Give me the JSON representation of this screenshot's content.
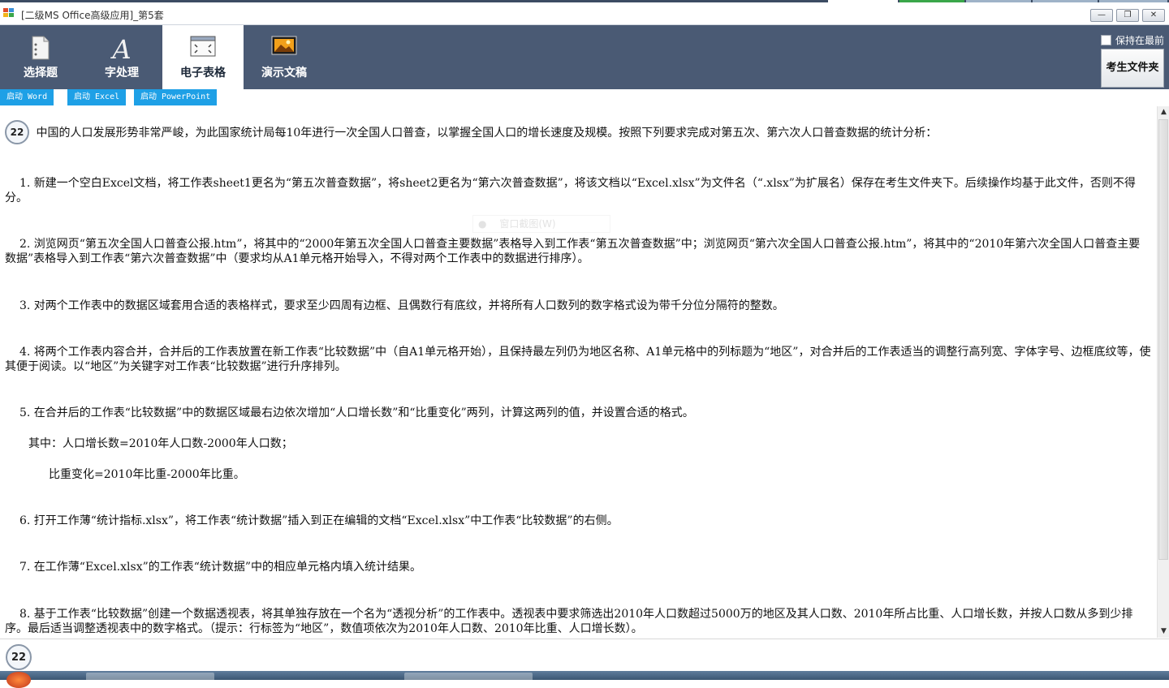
{
  "window": {
    "title": "[二级MS Office高级应用]_第5套",
    "controls": [
      "—",
      "❐",
      "✕"
    ]
  },
  "toolbar": {
    "tabs": [
      {
        "label": "选择题",
        "icon": "document-list-icon",
        "active": false
      },
      {
        "label": "字处理",
        "icon": "letter-a-icon",
        "active": false
      },
      {
        "label": "电子表格",
        "icon": "spreadsheet-icon",
        "active": true
      },
      {
        "label": "演示文稿",
        "icon": "slideshow-icon",
        "active": false
      }
    ],
    "keep_front_label": "保持在最前",
    "folder_button": "考生文件夹"
  },
  "launch_buttons": [
    "启动 Word",
    "启动 Excel",
    "启动 PowerPoint"
  ],
  "question": {
    "number": "22",
    "intro": "中国的人口发展形势非常严峻，为此国家统计局每10年进行一次全国人口普查，以掌握全国人口的增长速度及规模。按照下列要求完成对第五次、第六次人口普查数据的统计分析：",
    "steps": [
      "1. 新建一个空白Excel文档，将工作表sheet1更名为“第五次普查数据”，将sheet2更名为“第六次普查数据”，将该文档以“Excel.xlsx”为文件名（“.xlsx”为扩展名）保存在考生文件夹下。后续操作均基于此文件，否则不得分。",
      "2. 浏览网页“第五次全国人口普查公报.htm”，将其中的“2000年第五次全国人口普查主要数据”表格导入到工作表“第五次普查数据”中；浏览网页“第六次全国人口普查公报.htm”，将其中的“2010年第六次全国人口普查主要数据”表格导入到工作表“第六次普查数据”中（要求均从A1单元格开始导入，不得对两个工作表中的数据进行排序）。",
      "3. 对两个工作表中的数据区域套用合适的表格样式，要求至少四周有边框、且偶数行有底纹，并将所有人口数列的数字格式设为带千分位分隔符的整数。",
      "4. 将两个工作表内容合并，合并后的工作表放置在新工作表“比较数据”中（自A1单元格开始），且保持最左列仍为地区名称、A1单元格中的列标题为“地区”，对合并后的工作表适当的调整行高列宽、字体字号、边框底纹等，使其便于阅读。以“地区”为关键字对工作表“比较数据”进行升序排列。",
      "5. 在合并后的工作表“比较数据”中的数据区域最右边依次增加“人口增长数”和“比重变化”两列，计算这两列的值，并设置合适的格式。",
      "其中：人口增长数=2010年人口数-2000年人口数；",
      "比重变化=2010年比重-2000年比重。",
      "6. 打开工作薄“统计指标.xlsx”，将工作表“统计数据”插入到正在编辑的文档“Excel.xlsx”中工作表“比较数据”的右侧。",
      "7. 在工作薄“Excel.xlsx”的工作表“统计数据”中的相应单元格内填入统计结果。",
      "8. 基于工作表“比较数据”创建一个数据透视表，将其单独存放在一个名为“透视分析”的工作表中。透视表中要求筛选出2010年人口数超过5000万的地区及其人口数、2010年所占比重、人口增长数，并按人口数从多到少排序。最后适当调整透视表中的数字格式。（提示：行标签为“地区”，数值项依次为2010年人口数、2010年比重、人口增长数）。"
    ],
    "ghost_overlay": "窗口截图(W)"
  },
  "bottom_nav": {
    "current": "22"
  },
  "colors": {
    "toolbar_bg": "#4a5a74",
    "launch_bg": "#1ea0e6",
    "active_tab_bg": "#ffffff"
  }
}
